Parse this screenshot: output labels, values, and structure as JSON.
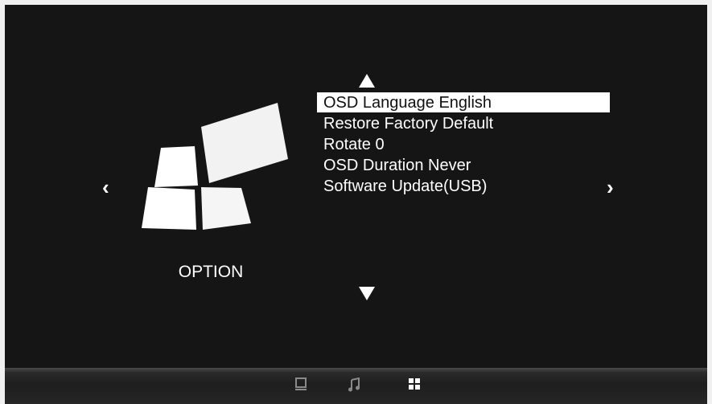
{
  "section": {
    "title": "OPTION",
    "icon": "option-blocks-icon"
  },
  "menu": {
    "items": [
      {
        "label": "OSD Language English",
        "selected": true
      },
      {
        "label": "Restore Factory Default",
        "selected": false
      },
      {
        "label": "Rotate 0",
        "selected": false
      },
      {
        "label": "OSD Duration Never",
        "selected": false
      },
      {
        "label": "Software Update(USB)",
        "selected": false
      }
    ]
  },
  "navigation": {
    "left": "‹",
    "right": "›",
    "up_icon": "up-arrow-icon",
    "down_icon": "down-arrow-icon"
  },
  "taskbar": {
    "icons": [
      "monitor-icon",
      "music-note-icon",
      "grid-icon"
    ],
    "active": "grid-icon"
  },
  "colors": {
    "background": "#151515",
    "text": "#ffffff",
    "highlight": "#ffffff",
    "highlight_text": "#111111"
  }
}
